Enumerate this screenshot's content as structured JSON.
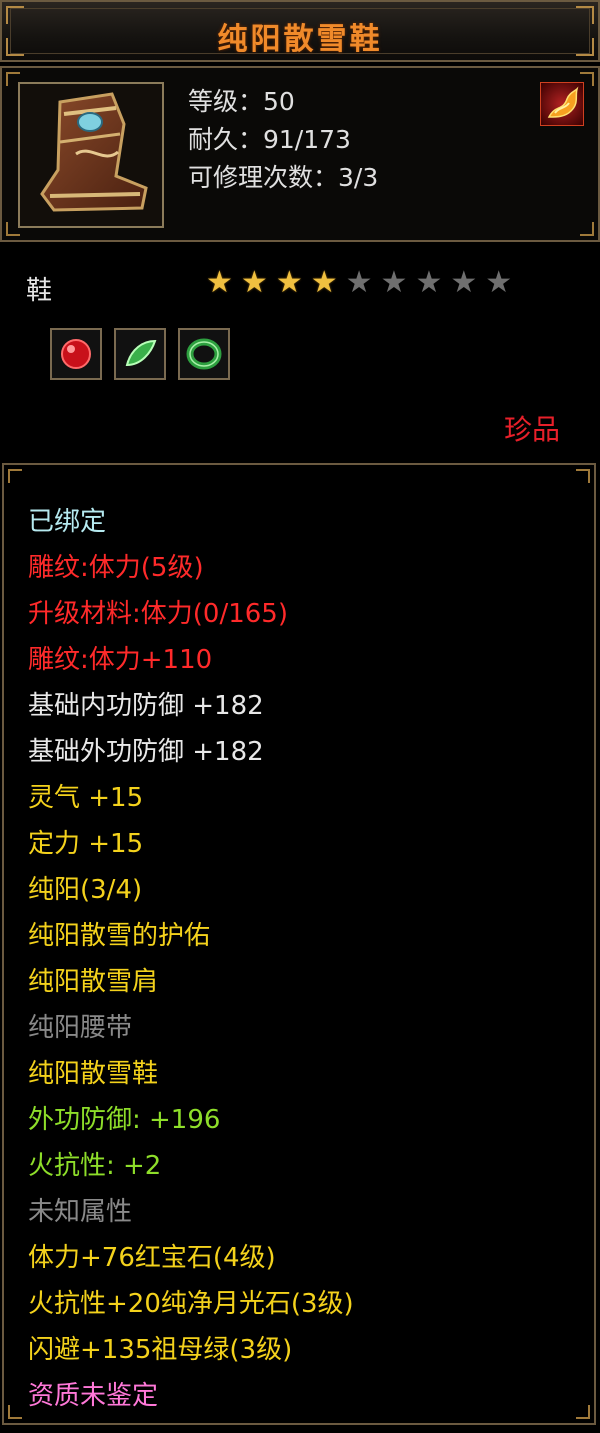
{
  "window": {
    "title": "纯阳散雪鞋"
  },
  "item": {
    "icon_name": "boot-icon",
    "level_label": "等级：50",
    "durability_label": "耐久：91/173",
    "repair_label": "可修理次数：3/3",
    "badge_icon": "fire-badge-icon",
    "type": "鞋",
    "stars_filled": 4,
    "stars_total": 9,
    "gems": [
      "ruby-gem-icon",
      "moonstone-gem-icon",
      "emerald-gem-icon"
    ],
    "rarity": "珍品"
  },
  "attributes": [
    {
      "text": "已绑定",
      "color": "cyan"
    },
    {
      "text": "雕纹:体力(5级)",
      "color": "red"
    },
    {
      "text": "升级材料:体力(0/165)",
      "color": "red"
    },
    {
      "text": "雕纹:体力+110",
      "color": "red"
    },
    {
      "text": "基础内功防御 +182",
      "color": "white"
    },
    {
      "text": "基础外功防御 +182",
      "color": "white"
    },
    {
      "text": "灵气 +15",
      "color": "yellow"
    },
    {
      "text": "定力 +15",
      "color": "yellow"
    },
    {
      "text": "纯阳(3/4)",
      "color": "yellow"
    },
    {
      "text": "纯阳散雪的护佑",
      "color": "yellow"
    },
    {
      "text": "纯阳散雪肩",
      "color": "yellow"
    },
    {
      "text": "纯阳腰带",
      "color": "gray"
    },
    {
      "text": "纯阳散雪鞋",
      "color": "yellow"
    },
    {
      "text": "外功防御: +196",
      "color": "green"
    },
    {
      "text": "火抗性: +2",
      "color": "green"
    },
    {
      "text": "未知属性",
      "color": "gray"
    },
    {
      "text": "体力+76红宝石(4级)",
      "color": "yellow"
    },
    {
      "text": "火抗性+20纯净月光石(3级)",
      "color": "yellow"
    },
    {
      "text": "闪避+135祖母绿(3级)",
      "color": "yellow"
    },
    {
      "text": "资质未鉴定",
      "color": "pink"
    }
  ]
}
